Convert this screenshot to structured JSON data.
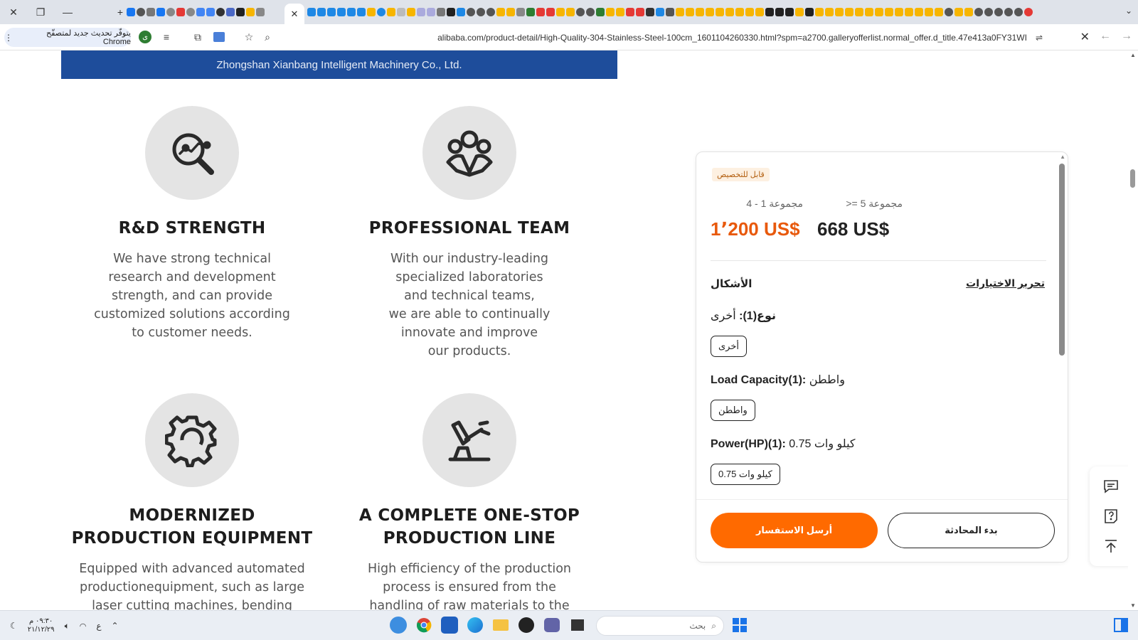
{
  "browser": {
    "url": "alibaba.com/product-detail/High-Quality-304-Stainless-Steel-100cm_1601104260330.html?spm=a2700.galleryofferlist.normal_offer.d_title.47e413a0FY31WI",
    "update_chip": "يتوفّر تحديث جديد لمتصفّح Chrome",
    "profile_letter": "ى"
  },
  "banner": {
    "company": "Zhongshan Xianbang Intelligent Machinery Co., Ltd."
  },
  "features": [
    {
      "title": "R&D STRENGTH",
      "desc": "We have strong technical\nresearch and development\nstrength, and can provide\ncustomized solutions according\nto customer needs.",
      "icon": "search-analytics-icon"
    },
    {
      "title": "PROFESSIONAL TEAM",
      "desc": "With our industry-leading\nspecialized laboratories\nand technical teams,\nwe are able to continually\ninnovate and improve\nour products.",
      "icon": "team-icon"
    },
    {
      "title": "MODERNIZED\nPRODUCTION EQUIPMENT",
      "desc": "Equipped with advanced automated\nproductionequipment, such as large\nlaser cutting machines,  bending",
      "icon": "gear-icon"
    },
    {
      "title": "A COMPLETE ONE-STOP\nPRODUCTION LINE",
      "desc": "High efficiency of the production\nprocess is ensured from the\nhandling of raw materials to the",
      "icon": "robot-arm-icon"
    }
  ],
  "panel": {
    "badge": "قابل للتخصيص",
    "tiers": [
      {
        "label": "مجموعة 1 - 4",
        "price": "1٬200 US$",
        "color": "#e8590c"
      },
      {
        "label": "مجموعة 5 =<",
        "price": "668 US$",
        "color": "#222222"
      }
    ],
    "variants_heading": "الأشكال",
    "edit_link": "تحرير الاختيارات",
    "options": [
      {
        "label": "نوع(1):",
        "value": "أخرى",
        "chip": "أخرى"
      },
      {
        "label": "Load Capacity(1):",
        "value": "واططن",
        "chip": "واططن"
      },
      {
        "label": "Power(HP)(1):",
        "value": "0.75 كيلو وات",
        "chip": "0.75 كيلو وات"
      }
    ],
    "chat_button": "بدء المحادثة",
    "inquiry_button": "أرسل الاستفسار"
  },
  "taskbar": {
    "search_placeholder": "بحث",
    "time": "٠٩:٣٠ م",
    "date": "٢١/١٢/٢٩",
    "lang": "ع"
  }
}
